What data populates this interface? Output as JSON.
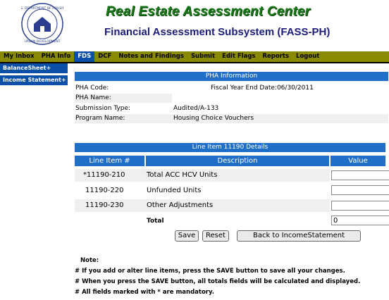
{
  "header": {
    "title": "Real Estate Assessment Center",
    "subtitle": "Financial Assessment Subsystem (FASS-PH)",
    "logo_icon": "hud-seal-icon"
  },
  "nav": {
    "items": [
      {
        "label": "My Inbox"
      },
      {
        "label": "PHA Info"
      },
      {
        "label": "FDS",
        "active": true
      },
      {
        "label": "DCF"
      },
      {
        "label": "Notes and Findings"
      },
      {
        "label": "Submit"
      },
      {
        "label": "Edit Flags"
      },
      {
        "label": "Reports"
      },
      {
        "label": "Logout"
      }
    ]
  },
  "sidebar": {
    "items": [
      {
        "label": "BalanceSheet+"
      },
      {
        "label": "Income Statement+"
      }
    ]
  },
  "pha_info": {
    "heading": "PHA Information",
    "pha_code_label": "PHA Code:",
    "pha_code_value": "",
    "fiscal_year_label": "Fiscal Year End Date:06/30/2011",
    "pha_name_label": "PHA Name:",
    "pha_name_value": "",
    "submission_type_label": "Submission Type:",
    "submission_type_value": "Audited/A-133",
    "program_name_label": "Program Name:",
    "program_name_value": "Housing Choice Vouchers"
  },
  "line_item": {
    "heading": "Line Item 11190 Details",
    "columns": [
      "Line Item #",
      "Description",
      "Value"
    ],
    "rows": [
      {
        "item": "*11190-210",
        "description": "Total ACC HCV Units",
        "value": ""
      },
      {
        "item": "11190-220",
        "description": "Unfunded Units",
        "value": ""
      },
      {
        "item": "11190-230",
        "description": "Other Adjustments",
        "value": ""
      }
    ],
    "total_label": "Total",
    "total_value": "0"
  },
  "buttons": {
    "save": "Save",
    "reset": "Reset",
    "back": "Back to IncomeStatement"
  },
  "notes": {
    "heading": "Note:",
    "lines": [
      "# If you add or alter line items, press the SAVE button to save all your changes.",
      "# When you press the SAVE button, all totals fields will be calculated and displayed.",
      "# All fields marked with * are mandatory."
    ]
  },
  "colors": {
    "nav_bg": "#8a8a00",
    "accent_blue": "#1f6fc8",
    "title_green": "#1a7a1a",
    "subtitle_navy": "#1d1d7a"
  }
}
